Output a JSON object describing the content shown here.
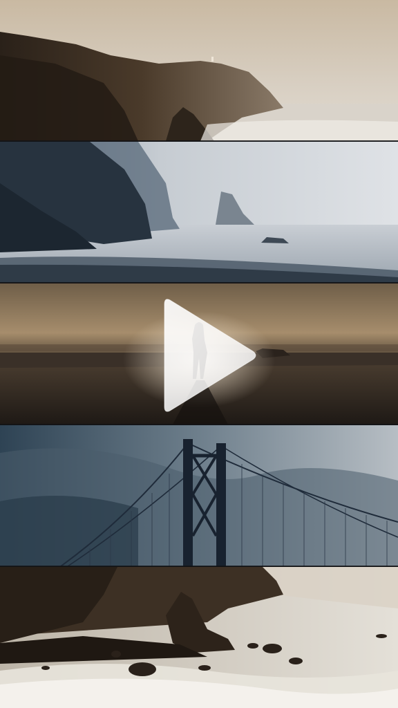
{
  "video": {
    "state": "paused",
    "play_icon": "play-icon",
    "accent": "#ffffff"
  },
  "collage": {
    "strips": [
      {
        "name": "strip-misty-cliff-lighthouse",
        "icon": "landscape-photo"
      },
      {
        "name": "strip-blue-sea-stacks",
        "icon": "landscape-photo"
      },
      {
        "name": "strip-figure-on-beach",
        "icon": "landscape-photo"
      },
      {
        "name": "strip-suspension-bridge",
        "icon": "landscape-photo"
      },
      {
        "name": "strip-rocky-coast-waves",
        "icon": "landscape-photo"
      }
    ]
  }
}
